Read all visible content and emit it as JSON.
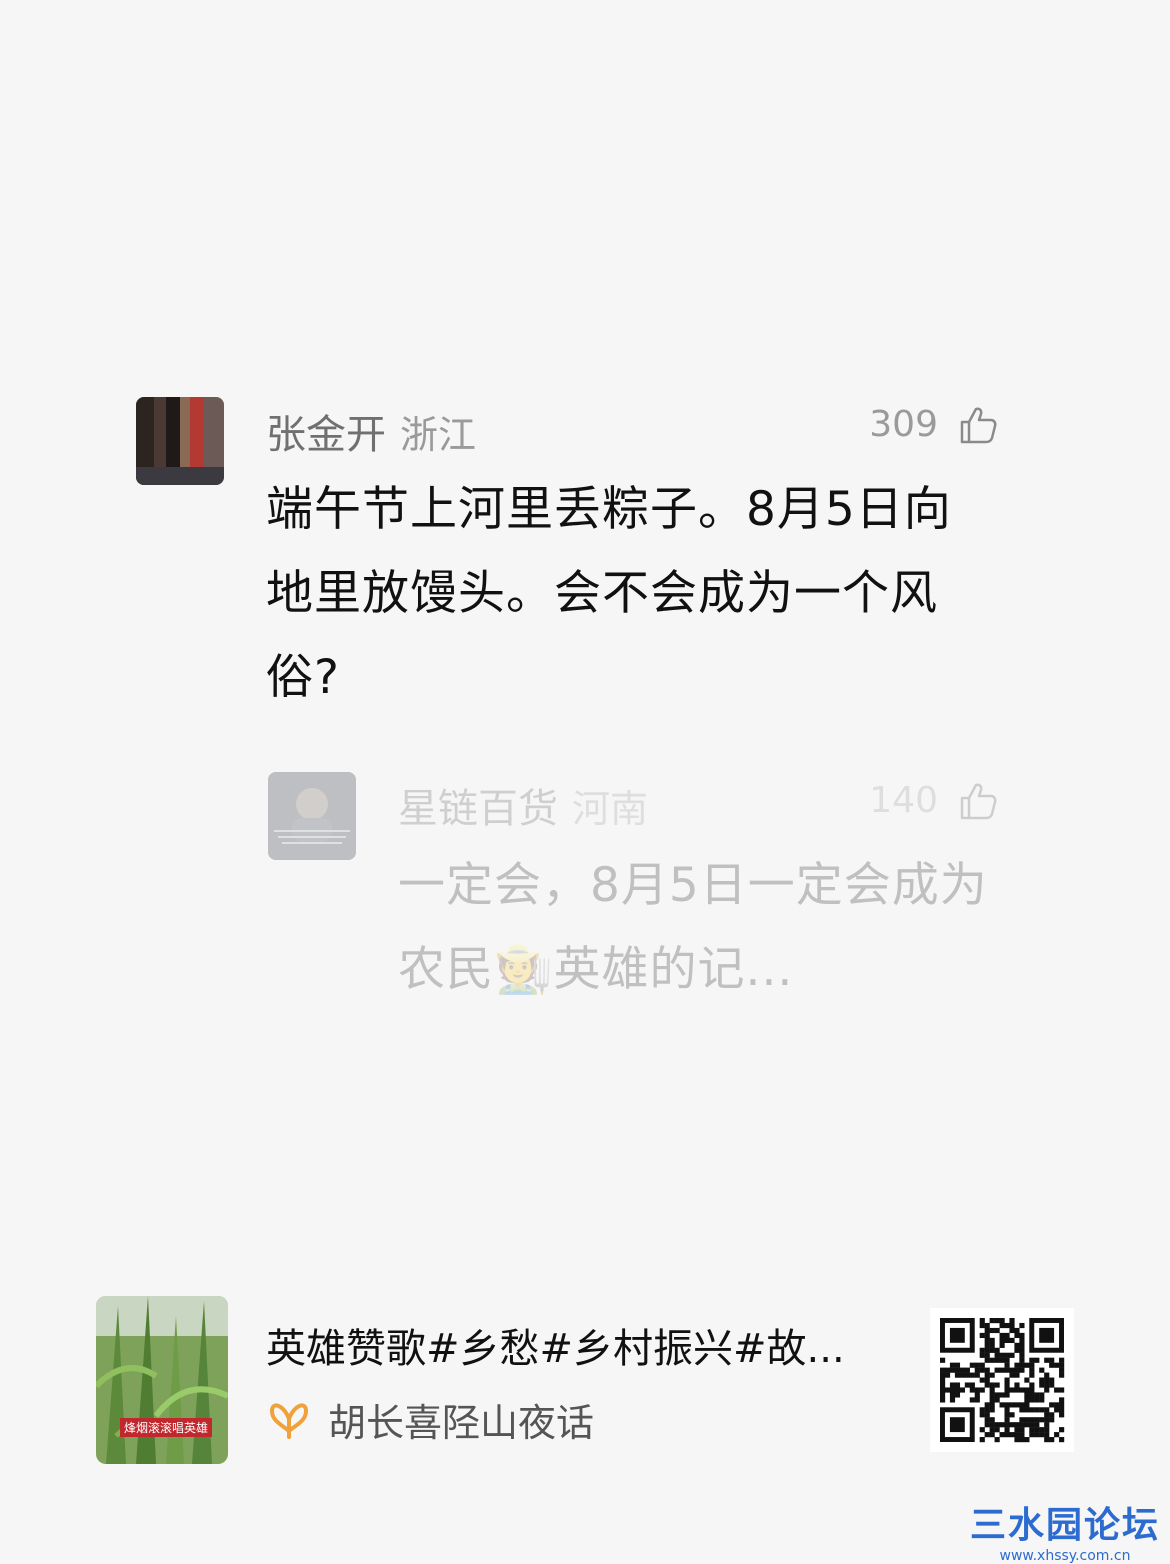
{
  "comment1": {
    "user": "张金开",
    "region": "浙江",
    "likes": "309",
    "text": "端午节上河里丢粽子。8月5日向地里放馒头。会不会成为一个风俗?"
  },
  "comment2": {
    "user": "星链百货",
    "region": "河南",
    "likes": "140",
    "text": "一定会，8月5日一定会成为农民🧑‍🌾英雄的记..."
  },
  "card": {
    "title": "英雄赞歌#乡愁#乡村振兴#故...",
    "author": "胡长喜陉山夜话",
    "thumb_caption": "烽烟滚滚唱英雄"
  },
  "watermark": {
    "main": "三水园论坛",
    "sub": "www.xhssy.com.cn"
  },
  "icons": {
    "like": "thumbs-up-icon",
    "author": "butterfly-icon",
    "qr": "qr-code-icon"
  }
}
